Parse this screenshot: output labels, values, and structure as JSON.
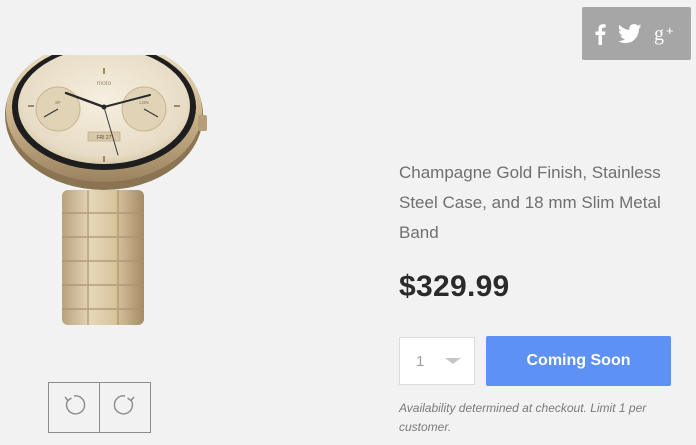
{
  "product": {
    "description": "Champagne Gold Finish, Stainless Steel Case, and 18 mm Slim Metal Band",
    "price": "$329.99",
    "image_alt": "moto 360 smartwatch, champagne gold",
    "watch_brand": "moto",
    "subdial_left": "SF",
    "subdial_right": "LON",
    "date_window": "FRI 27"
  },
  "purchase": {
    "quantity": "1",
    "cta_label": "Coming Soon",
    "availability_note": "Availability determined at checkout. Limit 1 per customer."
  },
  "social": {
    "icons": [
      "facebook-icon",
      "twitter-icon",
      "google-plus-icon"
    ]
  },
  "image_controls": {
    "icons": [
      "rotate-left-icon",
      "rotate-right-icon"
    ]
  },
  "colors": {
    "accent": "#5e91f4",
    "social_bg": "#a6a6a6",
    "page_bg": "#f2f2f2",
    "gold": "#d9c8a4"
  }
}
